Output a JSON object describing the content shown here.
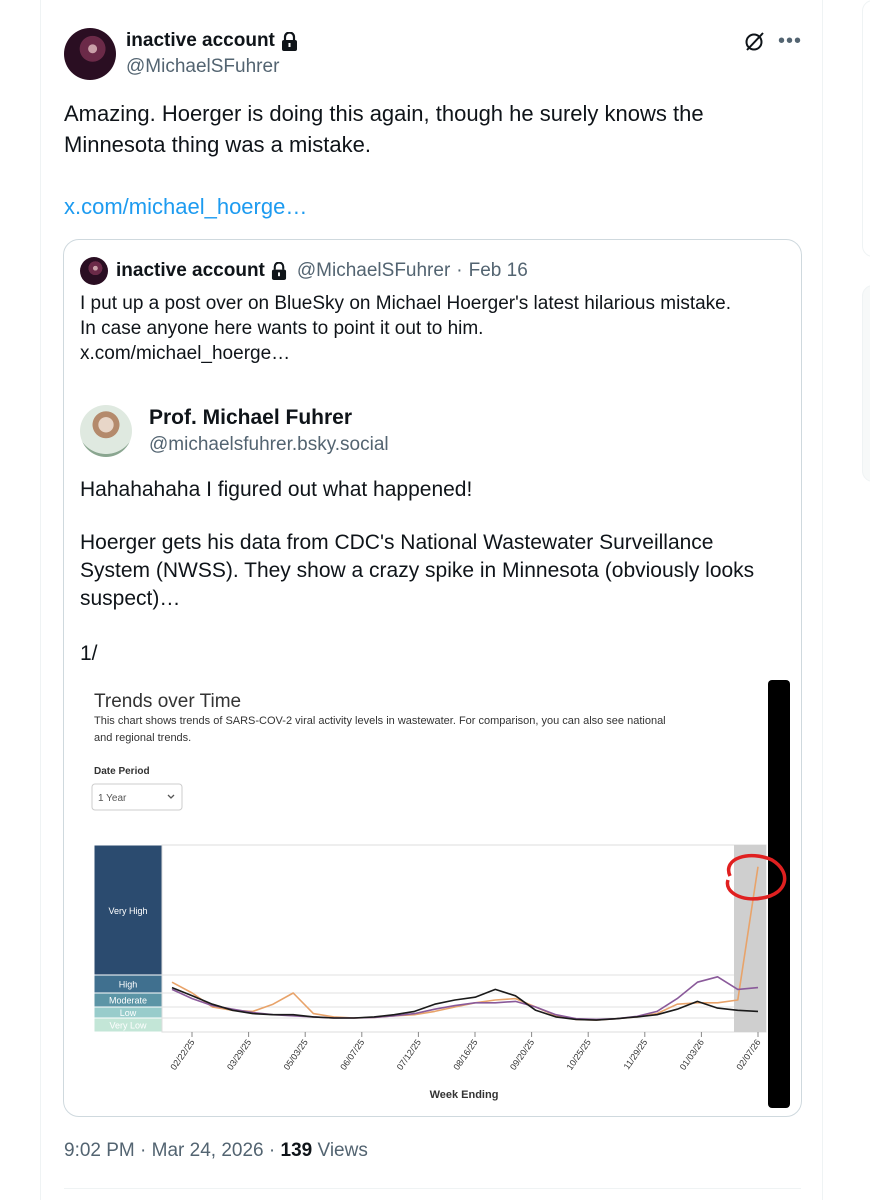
{
  "tweet": {
    "display_name": "inactive account",
    "handle": "@MichaelSFuhrer",
    "text_line1": "Amazing. Hoerger is doing this again, though he surely knows the",
    "text_line2": "Minnesota thing was a mistake.",
    "link": "x.com/michael_hoerge…",
    "time": "9:02 PM",
    "date": "Mar 24, 2026",
    "views_count": "139",
    "views_label": "Views",
    "icons": [
      "lock-icon",
      "grok-icon",
      "more-icon"
    ]
  },
  "quote": {
    "display_name": "inactive account",
    "handle": "@MichaelSFuhrer",
    "date": "Feb 16",
    "line1": "I put up a post over on BlueSky on Michael Hoerger's latest hilarious mistake.",
    "line2": "In case anyone here wants to point it out to him.",
    "line3": "x.com/michael_hoerge…"
  },
  "bsky_post": {
    "name": "Prof. Michael Fuhrer",
    "handle": "@michaelsfuhrer.bsky.social",
    "p1": "Hahahahaha I figured out what happened!",
    "p2_line1": "Hoerger gets his data from CDC's National Wastewater Surveillance",
    "p2_line2": "System (NWSS). They show a crazy spike in Minnesota (obviously looks",
    "p2_line3": "suspect)…",
    "p3": "1/"
  },
  "chart_data": {
    "type": "line",
    "title": "Trends over Time",
    "subtitle_line1": "This chart shows trends of SARS-COV-2 viral activity levels in wastewater. For comparison, you can also see national",
    "subtitle_line2": "and regional trends.",
    "date_period_label": "Date Period",
    "date_period_value": "1 Year",
    "xlabel": "Week Ending",
    "x_ticks": [
      "02/22/25",
      "03/29/25",
      "05/03/25",
      "06/07/25",
      "07/12/25",
      "08/16/25",
      "09/20/25",
      "10/25/25",
      "11/29/25",
      "01/03/26",
      "02/07/26"
    ],
    "levels": [
      "Very High",
      "High",
      "Moderate",
      "Low",
      "Very Low"
    ],
    "level_colors": [
      "#2b4b6f",
      "#40708f",
      "#5c95a6",
      "#98cccb",
      "#c3e6d7"
    ],
    "series": [
      {
        "color": "#e8a36a",
        "values": [
          3.6,
          3.0,
          2.0,
          1.7,
          1.6,
          2.2,
          3.0,
          1.4,
          1.1,
          1.0,
          1.05,
          1.2,
          1.3,
          1.6,
          2.0,
          2.3,
          2.5,
          2.6,
          2.0,
          1.2,
          0.9,
          0.85,
          0.95,
          1.1,
          1.4,
          2.2,
          2.3,
          2.3,
          2.5,
          9.0
        ]
      },
      {
        "color": "#8a5a9a",
        "values": [
          3.2,
          2.6,
          2.1,
          1.8,
          1.5,
          1.3,
          1.2,
          1.1,
          1.0,
          1.0,
          1.05,
          1.2,
          1.4,
          1.8,
          2.1,
          2.3,
          2.3,
          2.4,
          2.0,
          1.3,
          0.95,
          0.9,
          0.95,
          1.15,
          1.6,
          2.6,
          3.6,
          3.9,
          3.2,
          3.3
        ]
      },
      {
        "color": "#1a1a1a",
        "values": [
          3.3,
          2.8,
          2.2,
          1.7,
          1.4,
          1.3,
          1.3,
          1.1,
          1.0,
          1.0,
          1.1,
          1.3,
          1.6,
          2.2,
          2.5,
          2.7,
          3.2,
          2.8,
          1.7,
          1.1,
          0.9,
          0.85,
          0.95,
          1.1,
          1.3,
          1.8,
          2.4,
          1.9,
          1.7,
          1.6
        ]
      }
    ],
    "highlight": "circled spike at 02/07/26"
  }
}
